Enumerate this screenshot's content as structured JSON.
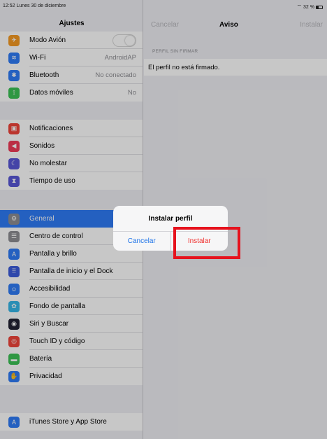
{
  "status": {
    "time": "12:52",
    "date": "Lunes 30 de diciembre",
    "battery": "32 %"
  },
  "sidebar": {
    "title": "Ajustes",
    "group1": [
      {
        "label": "Modo Avión",
        "icon": "airplane-icon",
        "color": "#f59a23",
        "glyph": "✈",
        "toggle": true
      },
      {
        "label": "Wi-Fi",
        "icon": "wifi-icon",
        "color": "#2f7cf6",
        "glyph": "≋",
        "value": "AndroidAP"
      },
      {
        "label": "Bluetooth",
        "icon": "bluetooth-icon",
        "color": "#2f7cf6",
        "glyph": "✱",
        "value": "No conectado"
      },
      {
        "label": "Datos móviles",
        "icon": "cellular-icon",
        "color": "#3cc255",
        "glyph": "⟟",
        "value": "No"
      }
    ],
    "group2": [
      {
        "label": "Notificaciones",
        "icon": "notifications-icon",
        "color": "#f0443a",
        "glyph": "▣"
      },
      {
        "label": "Sonidos",
        "icon": "sounds-icon",
        "color": "#f03b58",
        "glyph": "◀"
      },
      {
        "label": "No molestar",
        "icon": "do-not-disturb-icon",
        "color": "#5856d6",
        "glyph": "☾"
      },
      {
        "label": "Tiempo de uso",
        "icon": "screen-time-icon",
        "color": "#5856d6",
        "glyph": "⧗"
      }
    ],
    "group3": [
      {
        "label": "General",
        "icon": "gear-icon",
        "color": "#8e8e93",
        "glyph": "⚙",
        "selected": true
      },
      {
        "label": "Centro de control",
        "icon": "control-center-icon",
        "color": "#8e8e93",
        "glyph": "☰"
      },
      {
        "label": "Pantalla y brillo",
        "icon": "display-icon",
        "color": "#2f7cf6",
        "glyph": "A"
      },
      {
        "label": "Pantalla de inicio y el Dock",
        "icon": "home-screen-icon",
        "color": "#3b5bdb",
        "glyph": "⠿"
      },
      {
        "label": "Accesibilidad",
        "icon": "accessibility-icon",
        "color": "#2f7cf6",
        "glyph": "☺"
      },
      {
        "label": "Fondo de pantalla",
        "icon": "wallpaper-icon",
        "color": "#36b6e8",
        "glyph": "✿"
      },
      {
        "label": "Siri y Buscar",
        "icon": "siri-icon",
        "color": "#222233",
        "glyph": "◉"
      },
      {
        "label": "Touch ID y código",
        "icon": "touch-id-icon",
        "color": "#f0443a",
        "glyph": "◎"
      },
      {
        "label": "Batería",
        "icon": "battery-icon",
        "color": "#3cc255",
        "glyph": "▬"
      },
      {
        "label": "Privacidad",
        "icon": "privacy-icon",
        "color": "#2f7cf6",
        "glyph": "✋"
      }
    ],
    "group4": [
      {
        "label": "iTunes Store y App Store",
        "icon": "app-store-icon",
        "color": "#2f7cf6",
        "glyph": "A"
      }
    ]
  },
  "detail": {
    "cancel_label": "Cancelar",
    "title": "Aviso",
    "install_label": "Instalar",
    "section_label": "PERFIL SIN FIRMAR",
    "message": "El perfil no está firmado."
  },
  "alert": {
    "title": "Instalar perfil",
    "cancel_label": "Cancelar",
    "install_label": "Instalar"
  }
}
